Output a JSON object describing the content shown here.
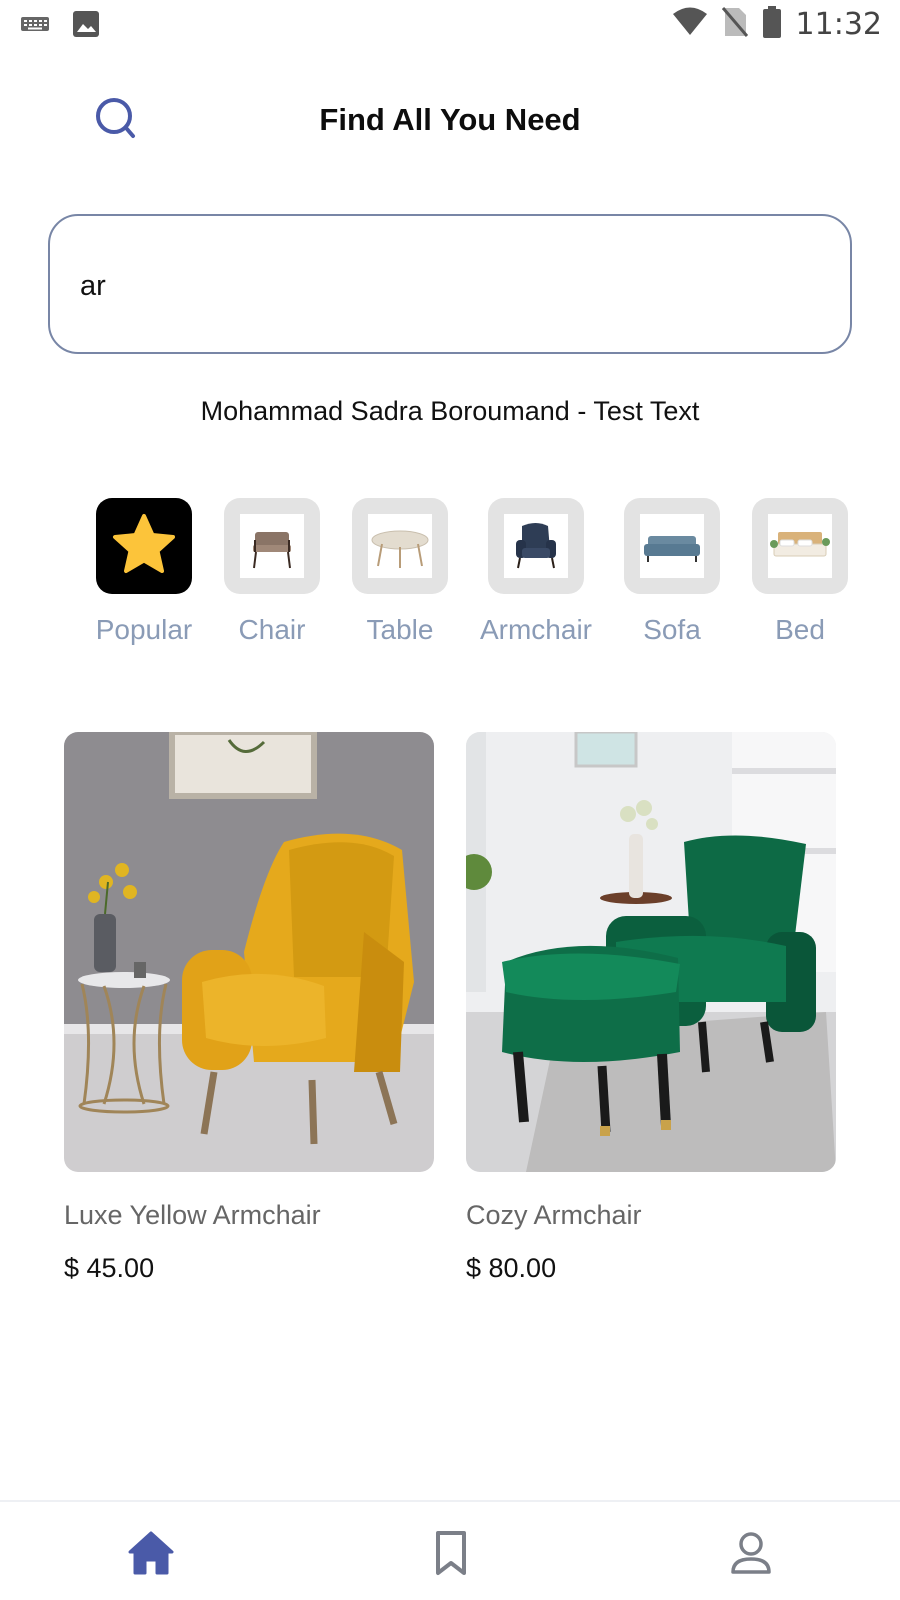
{
  "status_bar": {
    "time": "11:32",
    "left_icons": [
      "keyboard-icon",
      "image-icon"
    ],
    "right_icons": [
      "wifi-icon",
      "no-sim-icon",
      "battery-icon"
    ]
  },
  "header": {
    "title": "Find All You Need",
    "search_icon": "search-icon"
  },
  "search": {
    "value": "ar"
  },
  "subtitle": "Mohammad Sadra Boroumand - Test Text",
  "categories": [
    {
      "label": "Popular",
      "icon": "star-icon",
      "active": true
    },
    {
      "label": "Chair",
      "icon": "chair-thumbnail",
      "active": false
    },
    {
      "label": "Table",
      "icon": "table-thumbnail",
      "active": false
    },
    {
      "label": "Armchair",
      "icon": "armchair-thumbnail",
      "active": false
    },
    {
      "label": "Sofa",
      "icon": "sofa-thumbnail",
      "active": false
    },
    {
      "label": "Bed",
      "icon": "bed-thumbnail",
      "active": false
    }
  ],
  "products": [
    {
      "name": "Luxe Yellow Armchair",
      "price": "$ 45.00",
      "image": "yellow-armchair-photo"
    },
    {
      "name": "Cozy Armchair",
      "price": "$ 80.00",
      "image": "green-armchair-photo"
    }
  ],
  "bottom_nav": [
    {
      "icon": "home-icon",
      "active": true
    },
    {
      "icon": "bookmark-icon",
      "active": false
    },
    {
      "icon": "profile-icon",
      "active": false
    }
  ],
  "colors": {
    "accent": "#4a5aa8",
    "category_label": "#8a9bb6",
    "search_border": "#7886a6",
    "star": "#fcc43a"
  }
}
